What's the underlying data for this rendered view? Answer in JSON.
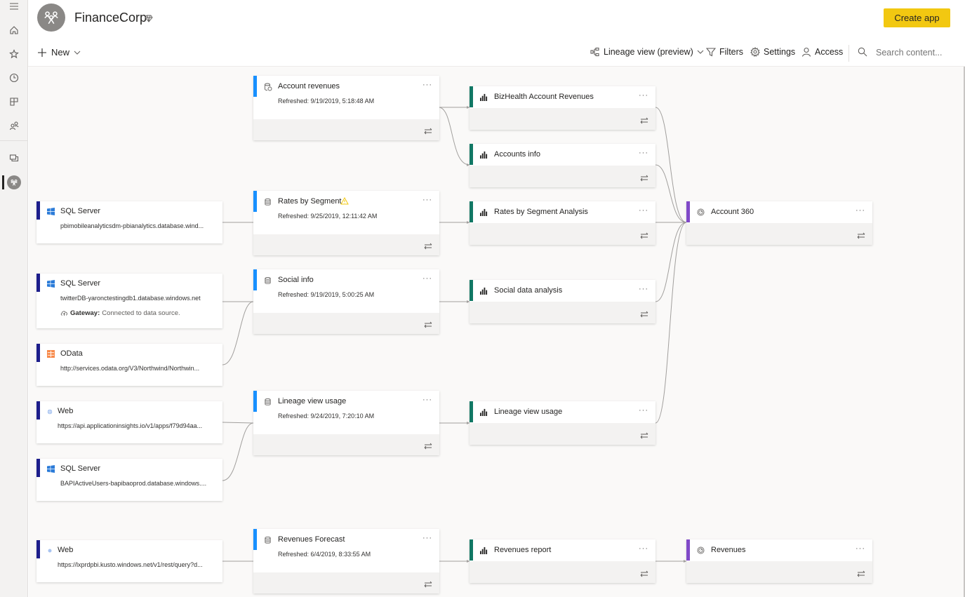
{
  "app": {
    "workspace_name": "FinanceCorp",
    "create_app_label": "Create app"
  },
  "leftnav": {
    "items": [
      "menu",
      "home",
      "favorites",
      "recent",
      "apps",
      "shared-with-me",
      "workspaces",
      "current-workspace"
    ]
  },
  "toolbar": {
    "new_label": "New",
    "lineage_label": "Lineage view (preview)",
    "filters_label": "Filters",
    "settings_label": "Settings",
    "access_label": "Access",
    "search_placeholder": "Search content..."
  },
  "colors": {
    "create_app": "#f2c811",
    "source_accent": "#1d1e8c",
    "dataset_accent": "#1890ff",
    "report_accent": "#117865",
    "dashboard_accent": "#8049c8",
    "warning": "#f2c811"
  },
  "sources": [
    {
      "type": "SQL Server",
      "detail": "pbimobileanalyticsdm-pbianalytics.database.wind...",
      "icon": "windows-icon"
    },
    {
      "type": "SQL Server",
      "detail": "twitterDB-yaronctestingdb1.database.windows.net",
      "icon": "windows-icon",
      "gateway_label": "Gateway:",
      "gateway_status": "Connected to data source."
    },
    {
      "type": "OData",
      "detail": "http://services.odata.org/V3/Northwind/Northwin...",
      "icon": "odata-icon"
    },
    {
      "type": "Web",
      "detail": "https://api.applicationinsights.io/v1/apps/f79d94aa...",
      "icon": "globe-icon"
    },
    {
      "type": "SQL Server",
      "detail": "BAPIActiveUsers-bapibaoprod.database.windows....",
      "icon": "windows-icon"
    },
    {
      "type": "Web",
      "detail": "https://lxprdpbi.kusto.windows.net/v1/rest/query?d...",
      "icon": "globe-icon"
    }
  ],
  "datasets": [
    {
      "name": "Account revenues",
      "refreshed": "Refreshed: 9/19/2019, 5:18:48 AM",
      "icon": "dataflow-icon"
    },
    {
      "name": "Rates by Segment",
      "refreshed": "Refreshed: 9/25/2019, 12:11:42 AM",
      "icon": "dataset-icon",
      "warning": true
    },
    {
      "name": "Social info",
      "refreshed": "Refreshed: 9/19/2019, 5:00:25 AM",
      "icon": "dataset-icon"
    },
    {
      "name": "Lineage view usage",
      "refreshed": "Refreshed: 9/24/2019, 7:20:10 AM",
      "icon": "dataset-icon"
    },
    {
      "name": "Revenues Forecast",
      "refreshed": "Refreshed: 6/4/2019, 8:33:55 AM",
      "icon": "dataset-icon"
    }
  ],
  "reports": [
    {
      "name": "BizHealth Account Revenues"
    },
    {
      "name": "Accounts info"
    },
    {
      "name": "Rates by Segment Analysis"
    },
    {
      "name": "Social data analysis"
    },
    {
      "name": "Lineage view usage"
    },
    {
      "name": "Revenues report"
    }
  ],
  "dashboards": [
    {
      "name": "Account 360"
    },
    {
      "name": "Revenues"
    }
  ],
  "card_more_label": "···"
}
